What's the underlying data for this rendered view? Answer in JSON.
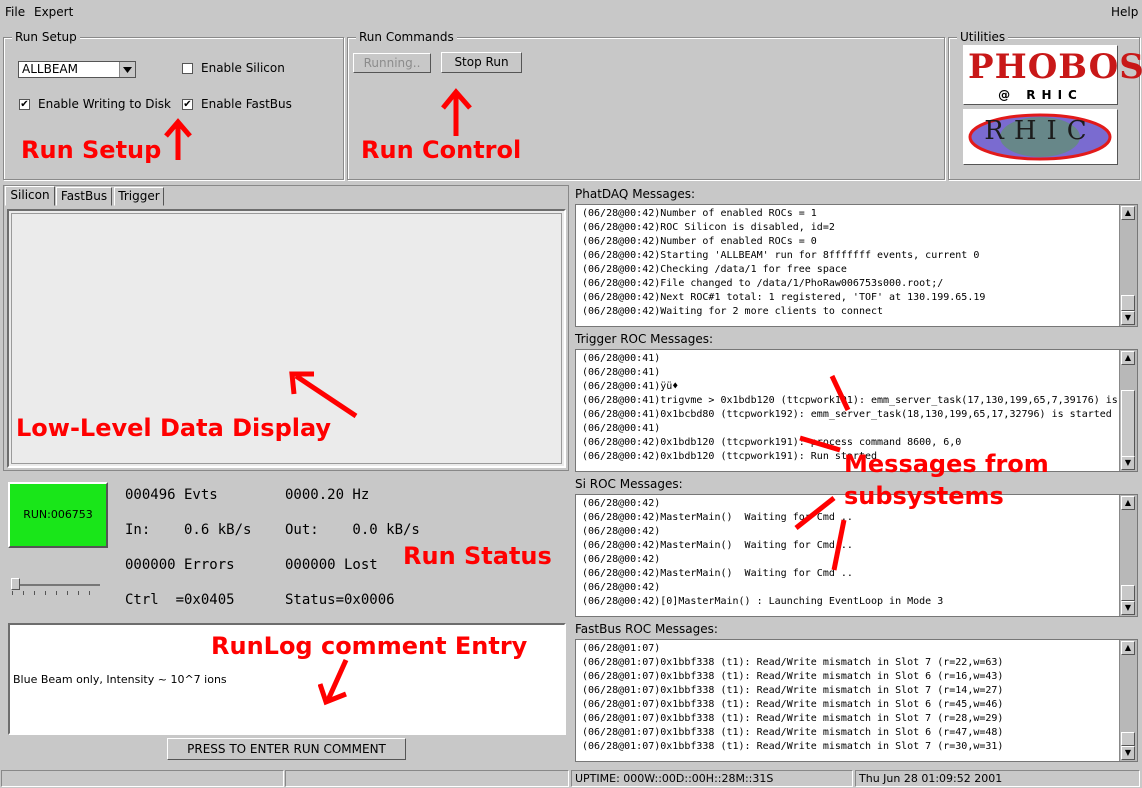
{
  "menubar": {
    "file": "File",
    "expert": "Expert",
    "help": "Help"
  },
  "run_setup": {
    "title": "Run Setup",
    "mode_value": "ALLBEAM",
    "enable_silicon": {
      "label": "Enable Silicon",
      "checked": false
    },
    "enable_writing": {
      "label": "Enable Writing to Disk",
      "checked": true
    },
    "enable_fastbus": {
      "label": "Enable FastBus",
      "checked": true
    }
  },
  "run_commands": {
    "title": "Run Commands",
    "running_label": "Running..",
    "stop_label": "Stop Run"
  },
  "utilities": {
    "title": "Utilities",
    "phobos_top": "PHOBOS",
    "phobos_bottom": "@ RHIC",
    "rhic": "RHIC"
  },
  "annotations": {
    "run_setup": "Run Setup",
    "run_control": "Run Control",
    "low_level": "Low-Level Data Display",
    "messages_line1": "Messages from",
    "messages_line2": "subsystems",
    "run_status": "Run Status",
    "runlog": "RunLog comment Entry"
  },
  "tabs": [
    "Silicon",
    "FastBus",
    "Trigger"
  ],
  "status": {
    "run_label": "RUN:006753",
    "run_color": "#19e619",
    "evts": "000496 Evts",
    "rate": "0000.20 Hz",
    "in": "In:    0.6 kB/s",
    "out": "Out:    0.0 kB/s",
    "errors": "000000 Errors",
    "lost": "000000 Lost",
    "ctrl": "Ctrl  =0x0405",
    "status": "Status=0x0006"
  },
  "comment": {
    "text": "Blue Beam only, Intensity ~ 10^7 ions",
    "button_label": "PRESS TO ENTER RUN COMMENT"
  },
  "panels": {
    "phatdaq": {
      "title": "PhatDAQ Messages:",
      "lines": [
        "(06/28@00:42)Number of enabled ROCs = 1",
        "(06/28@00:42)ROC Silicon is disabled, id=2",
        "(06/28@00:42)Number of enabled ROCs = 0",
        "(06/28@00:42)Starting 'ALLBEAM' run for 8fffffff events, current 0",
        "(06/28@00:42)Checking /data/1 for free space",
        "(06/28@00:42)File changed to /data/1/PhoRaw006753s000.root;/",
        "(06/28@00:42)Next ROC#1 total: 1 registered, 'TOF' at 130.199.65.19",
        "(06/28@00:42)Waiting for 2 more clients to connect"
      ]
    },
    "trigger": {
      "title": "Trigger ROC Messages:",
      "lines": [
        "(06/28@00:41)",
        "(06/28@00:41)",
        "(06/28@00:41)ÿü♦",
        "(06/28@00:41)trigvme > 0x1bdb120 (ttcpwork191): emm_server_task(17,130,199,65,7,39176) is",
        "(06/28@00:41)0x1bcbd80 (ttcpwork192): emm_server_task(18,130,199,65,17,32796) is started",
        "(06/28@00:41)",
        "(06/28@00:42)0x1bdb120 (ttcpwork191): process command 8600, 6,0",
        "(06/28@00:42)0x1bdb120 (ttcpwork191): Run started"
      ]
    },
    "si": {
      "title": "Si ROC Messages:",
      "lines": [
        "(06/28@00:42)",
        "(06/28@00:42)MasterMain()  Waiting for Cmd ..",
        "(06/28@00:42)",
        "(06/28@00:42)MasterMain()  Waiting for Cmd ..",
        "(06/28@00:42)",
        "(06/28@00:42)MasterMain()  Waiting for Cmd ..",
        "(06/28@00:42)",
        "(06/28@00:42)[0]MasterMain() : Launching EventLoop in Mode 3"
      ]
    },
    "fastbus": {
      "title": "FastBus ROC Messages:",
      "lines": [
        "(06/28@01:07)",
        "(06/28@01:07)0x1bbf338 (t1): Read/Write mismatch in Slot 7 (r=22,w=63)",
        "(06/28@01:07)0x1bbf338 (t1): Read/Write mismatch in Slot 6 (r=16,w=43)",
        "(06/28@01:07)0x1bbf338 (t1): Read/Write mismatch in Slot 7 (r=14,w=27)",
        "(06/28@01:07)0x1bbf338 (t1): Read/Write mismatch in Slot 6 (r=45,w=46)",
        "(06/28@01:07)0x1bbf338 (t1): Read/Write mismatch in Slot 7 (r=28,w=29)",
        "(06/28@01:07)0x1bbf338 (t1): Read/Write mismatch in Slot 6 (r=47,w=48)",
        "(06/28@01:07)0x1bbf338 (t1): Read/Write mismatch in Slot 7 (r=30,w=31)"
      ]
    }
  },
  "statusbar": {
    "uptime": "UPTIME: 000W::00D::00H::28M::31S",
    "date": "Thu Jun 28 01:09:52 2001"
  }
}
